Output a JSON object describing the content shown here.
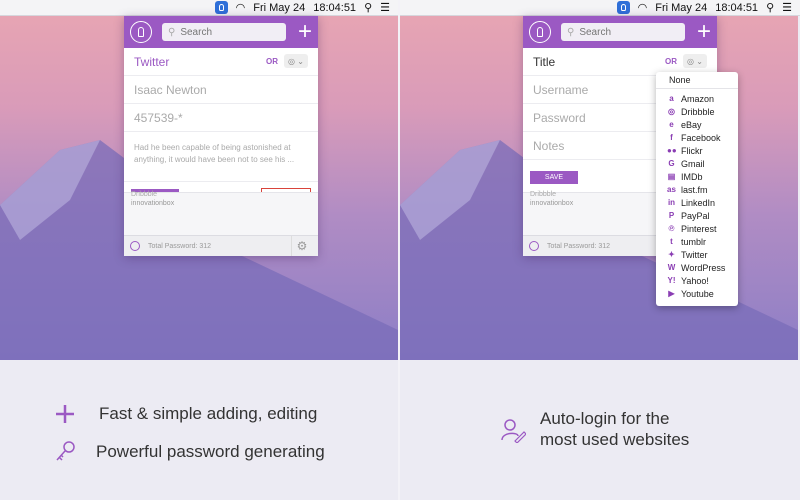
{
  "menubar": {
    "date": "Fri May 24",
    "time": "18:04:51"
  },
  "left_popup": {
    "search_placeholder": "Search",
    "title_value": "Twitter",
    "or_label": "OR",
    "username_value": "Isaac Newton",
    "password_value": "457539-*",
    "notes_value": "Had he been capable of being astonished at anything, it would have been not to see his ...",
    "save_label": "SAVE",
    "delete_label": "DELETE",
    "list_item_sub": "innovationbox",
    "list_item_cut": "Dribbble",
    "footer_text": "Total Password: 312"
  },
  "right_popup": {
    "search_placeholder": "Search",
    "title_placeholder": "Title",
    "or_label": "OR",
    "username_placeholder": "Username",
    "password_placeholder": "Password",
    "notes_placeholder": "Notes",
    "save_label": "SAVE",
    "list_item_sub": "innovationbox",
    "list_item_cut": "Dribbble",
    "footer_text": "Total Password: 312"
  },
  "dropdown": {
    "none_label": "None",
    "items": [
      {
        "label": "Amazon",
        "icon": "a"
      },
      {
        "label": "Dribbble",
        "icon": "◎"
      },
      {
        "label": "eBay",
        "icon": "e"
      },
      {
        "label": "Facebook",
        "icon": "f"
      },
      {
        "label": "Flickr",
        "icon": "●●"
      },
      {
        "label": "Gmail",
        "icon": "G"
      },
      {
        "label": "IMDb",
        "icon": "▤"
      },
      {
        "label": "last.fm",
        "icon": "as"
      },
      {
        "label": "LinkedIn",
        "icon": "in"
      },
      {
        "label": "PayPal",
        "icon": "P"
      },
      {
        "label": "Pinterest",
        "icon": "℗"
      },
      {
        "label": "tumblr",
        "icon": "t"
      },
      {
        "label": "Twitter",
        "icon": "✦"
      },
      {
        "label": "WordPress",
        "icon": "W"
      },
      {
        "label": "Yahoo!",
        "icon": "Y!"
      },
      {
        "label": "Youtube",
        "icon": "▶"
      }
    ]
  },
  "captions": {
    "feature1": "Fast & simple adding, editing",
    "feature2": "Powerful password generating",
    "feature3_line1": "Auto-login for the",
    "feature3_line2": "most used websites"
  }
}
